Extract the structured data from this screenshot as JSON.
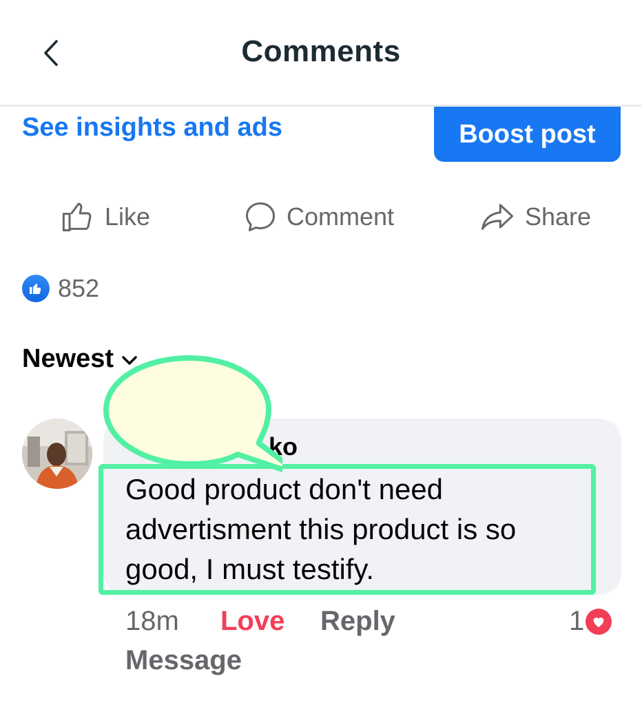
{
  "header": {
    "title": "Comments"
  },
  "post_actions": {
    "insights_label": "See insights and ads",
    "boost_label": "Boost post",
    "like_label": "Like",
    "comment_label": "Comment",
    "share_label": "Share"
  },
  "reactions": {
    "count": "852"
  },
  "sort": {
    "label": "Newest"
  },
  "comment": {
    "author_partial": "ko",
    "text": "Good product don't need advertisment this product is so good, I must testify.",
    "time": "18m",
    "love_label": "Love",
    "reply_label": "Reply",
    "message_label": "Message",
    "love_count": "1"
  },
  "colors": {
    "brand_blue": "#1877f2",
    "love_red": "#f33e58",
    "highlight_green": "#52f0a4",
    "speech_fill": "#fffde0"
  }
}
